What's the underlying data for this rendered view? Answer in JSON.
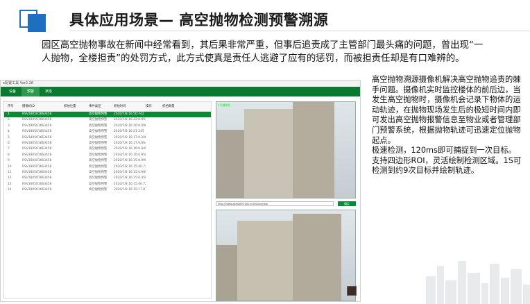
{
  "slide": {
    "title": "具体应用场景— 高空抛物检测预警溯源",
    "intro": "园区高空抛物事故在新闻中经常看到，其后果非常严重，但事后追责成了主管部门最头痛的问题，曾出现“一人抛物，全楼担责”的处罚方式，此方式使真是责任人逃避了应有的惩罚，而被担责任却是有口难辨的。",
    "description": "高空抛物溯源摄像机解决高空抛物追责的棘手问题。摄像机实时监控楼体的前后边，当发生高空抛物时，摄像机会记录下物体的运动轨迹，在抛物现场发生后的极短时间内即可发出高空抛物报警信息至物业或者管理部门预警系统，根据抛物轨迹可迅速定位抛物起点。\n极速检测，120ms即可捕捉到一次目标。支持四边形ROI，灵活绘制检测区域。1S可检测到约9次目标并绘制轨迹。",
    "accent_color": "#1f6fc0"
  },
  "app": {
    "window_title": "e配置工具 Ver2.28",
    "menu": [
      "设备",
      "预警",
      "状态"
    ],
    "active_menu": "预警",
    "columns": [
      "序号",
      "摄像机ID",
      "抓拍位置",
      "事件类型",
      "抓拍时间",
      "操作",
      "抓拍数量"
    ],
    "rows": [
      [
        "1",
        "RSV180501663458",
        "",
        "高空抛物预警",
        "2020/7/8 16:50:742",
        "",
        ""
      ],
      [
        "2",
        "RSV180501663458",
        "",
        "高空抛物预警",
        "2020/7/8 16:22:0.993",
        "",
        ""
      ],
      [
        "3",
        "RSV180501663458",
        "",
        "高空抛物预警",
        "2020/7/8 16:26:0.098",
        "",
        ""
      ],
      [
        "4",
        "RSV180501663458",
        "",
        "高空抛物预警",
        "2020/7/8 16:21:245",
        "",
        ""
      ],
      [
        "5",
        "RSV180501663458",
        "",
        "高空抛物预警",
        "2020/7/8 16:17:0.206",
        "",
        ""
      ],
      [
        "6",
        "RSV180501663458",
        "",
        "高空抛物预警",
        "2020/7/8 16:17:0.664",
        "",
        ""
      ],
      [
        "7",
        "RSV180501663458",
        "",
        "高空抛物预警",
        "2020/7/8 16:16:0.949",
        "",
        ""
      ],
      [
        "8",
        "RSV180501663458",
        "",
        "高空抛物预警",
        "2020/7/8 16:16:0.950",
        "",
        ""
      ],
      [
        "9",
        "RSV180501663458",
        "",
        "高空抛物预警",
        "2020/7/8 16:15:0.990",
        "",
        ""
      ],
      [
        "10",
        "RSV180501663458",
        "",
        "高空抛物预警",
        "2020/7/8 16:15:40.720",
        "",
        ""
      ],
      [
        "11",
        "RSV180501663458",
        "",
        "高空抛物预警",
        "2020/7/8 16:15:0.989",
        "",
        ""
      ],
      [
        "12",
        "RSV180501663458",
        "",
        "高空抛物预警",
        "2020/7/8 16:15:0.458",
        "",
        ""
      ],
      [
        "13",
        "RSV180501663458",
        "",
        "高空抛物预警",
        "2020/7/8 16:15:40.720",
        "",
        ""
      ],
      [
        "14",
        "RSV180501663458",
        "",
        "高空抛物预警",
        "2020/7/8 16:15:17.876",
        "",
        ""
      ]
    ],
    "selected_row": 0,
    "url": "http://video.abcd/000.000.0.000/xxx/rtsp",
    "go_button": "确定",
    "camera_overlay": "1号摄像机"
  }
}
